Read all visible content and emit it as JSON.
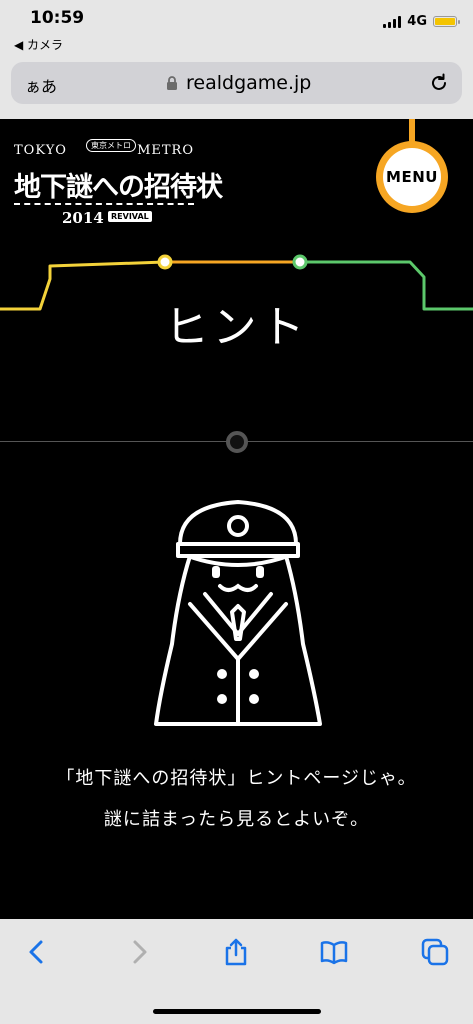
{
  "status_bar": {
    "time": "10:59",
    "back_app": "◀ カメラ",
    "network": "4G",
    "battery_color": "#f4c400"
  },
  "url_bar": {
    "reader_label": "ぁあ",
    "url": "realdgame.jp",
    "lock_icon": "lock-icon",
    "reload_icon": "reload-icon"
  },
  "page": {
    "logo": {
      "top_left": "TOKYO",
      "top_right": "METRO",
      "sub": "東京メトロ",
      "main": "地下謎への招待状",
      "year": "2014",
      "revival": "REVIVAL"
    },
    "menu_label": "MENU",
    "title": "ヒント",
    "hint_line_1": "「地下謎への招待状」ヒントページじゃ。",
    "hint_line_2": "謎に詰まったら見るとよいぞ。",
    "colors": {
      "yellow_line": "#f3d23a",
      "orange_line": "#f6a623",
      "green_line": "#5cc86b",
      "menu_accent": "#f6a623"
    }
  },
  "toolbar": {
    "icons": [
      "back-icon",
      "forward-icon",
      "share-icon",
      "bookmarks-icon",
      "tabs-icon"
    ]
  }
}
